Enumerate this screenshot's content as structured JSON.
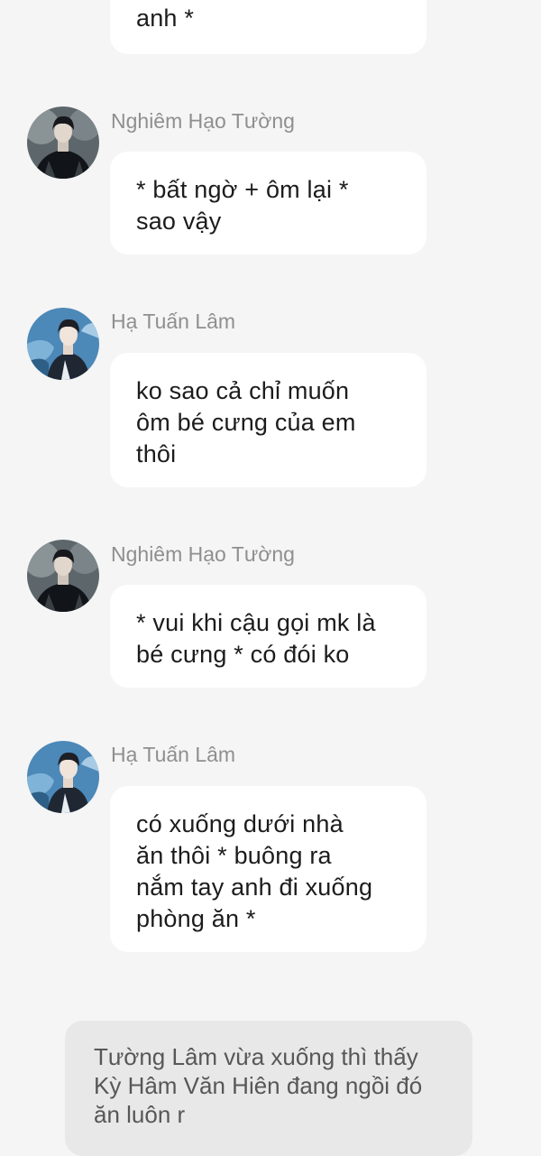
{
  "chat": {
    "messages": [
      {
        "text": "anh *"
      },
      {
        "sender": "Nghiêm Hạo Tường",
        "avatar": "avatar-nghiem-hao-tuong",
        "text": "* bất ngờ + ôm lại *\nsao vậy"
      },
      {
        "sender": "Hạ Tuấn Lâm",
        "avatar": "avatar-ha-tuan-lam",
        "text": "ko sao cả chỉ muốn\nôm bé cưng của em\nthôi"
      },
      {
        "sender": "Nghiêm Hạo Tường",
        "avatar": "avatar-nghiem-hao-tuong",
        "text": "* vui khi cậu gọi mk là\nbé cưng * có đói ko"
      },
      {
        "sender": "Hạ Tuấn Lâm",
        "avatar": "avatar-ha-tuan-lam",
        "text": "có xuống dưới nhà\năn thôi * buông ra\nnắm tay anh đi xuống\nphòng ăn *"
      }
    ],
    "narration": "Tường Lâm vừa xuống thì thấy\nKỳ Hâm Văn Hiên đang ngồi đó\năn luôn r"
  }
}
